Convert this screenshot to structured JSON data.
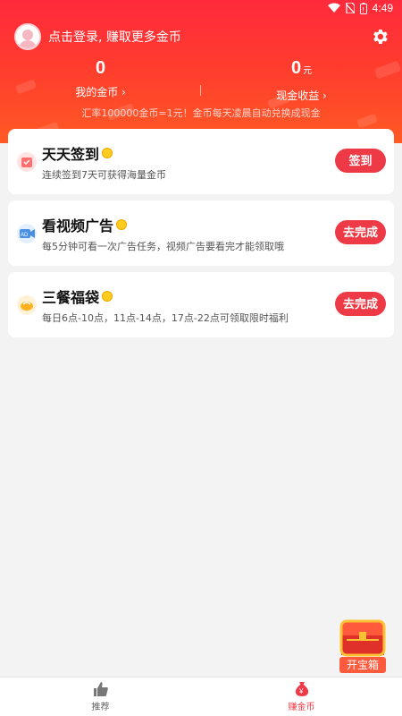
{
  "status_bar": {
    "time": "4:49"
  },
  "header": {
    "login_text": "点击登录, 赚取更多金币",
    "my_coins": {
      "value": "0",
      "label": "我的金币 ›"
    },
    "cash_income": {
      "value": "0",
      "unit": "元",
      "label": "现金收益 ›"
    },
    "notice": "汇率100000金币=1元！金币每天凌晨自动兑换成现金"
  },
  "tasks": [
    {
      "title": "天天签到",
      "desc": "连续签到7天可获得海量金币",
      "button": "签到",
      "icon": "calendar-icon",
      "color": "#ff6f6f"
    },
    {
      "title": "看视频广告",
      "desc": "每5分钟可看一次广告任务，视频广告要看完才能领取哦",
      "button": "去完成",
      "icon": "ad-video-icon",
      "color": "#4a90e2"
    },
    {
      "title": "三餐福袋",
      "desc": "每日6点-10点，11点-14点，17点-22点可领取限时福利",
      "button": "去完成",
      "icon": "meal-bag-icon",
      "color": "#ffb11b"
    }
  ],
  "chest": {
    "label": "开宝箱"
  },
  "tabbar": [
    {
      "label": "推荐",
      "icon": "thumbs-up-icon"
    },
    {
      "label": "赚金币",
      "icon": "money-bag-icon"
    }
  ],
  "colors": {
    "primary_red": "#ee3a47",
    "hero_top": "#ff2a3c",
    "hero_bottom": "#ff5a24"
  }
}
